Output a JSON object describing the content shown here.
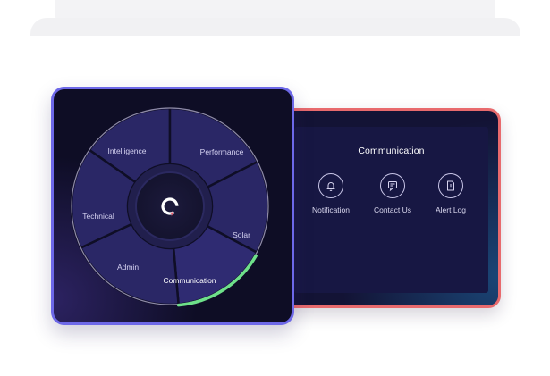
{
  "radial_menu": {
    "segments": [
      {
        "id": "intelligence",
        "label": "Intelligence"
      },
      {
        "id": "performance",
        "label": "Performance"
      },
      {
        "id": "solar",
        "label": "Solar"
      },
      {
        "id": "communication",
        "label": "Communication",
        "active": true
      },
      {
        "id": "admin",
        "label": "Admin"
      },
      {
        "id": "technical",
        "label": "Technical"
      }
    ],
    "center_icon": "power-logo-icon"
  },
  "communication_panel": {
    "title": "Communication",
    "items": [
      {
        "label": "Notification",
        "icon": "bell-icon"
      },
      {
        "label": "Contact Us",
        "icon": "chat-icon"
      },
      {
        "label": "Alert Log",
        "icon": "document-alert-icon"
      }
    ]
  },
  "colors": {
    "menu_border": "#6d68e8",
    "comm_border": "#e86a6d",
    "active_arc": "#6ee08a",
    "panel_bg": "#131335",
    "segment_fill": "#2a2766"
  }
}
